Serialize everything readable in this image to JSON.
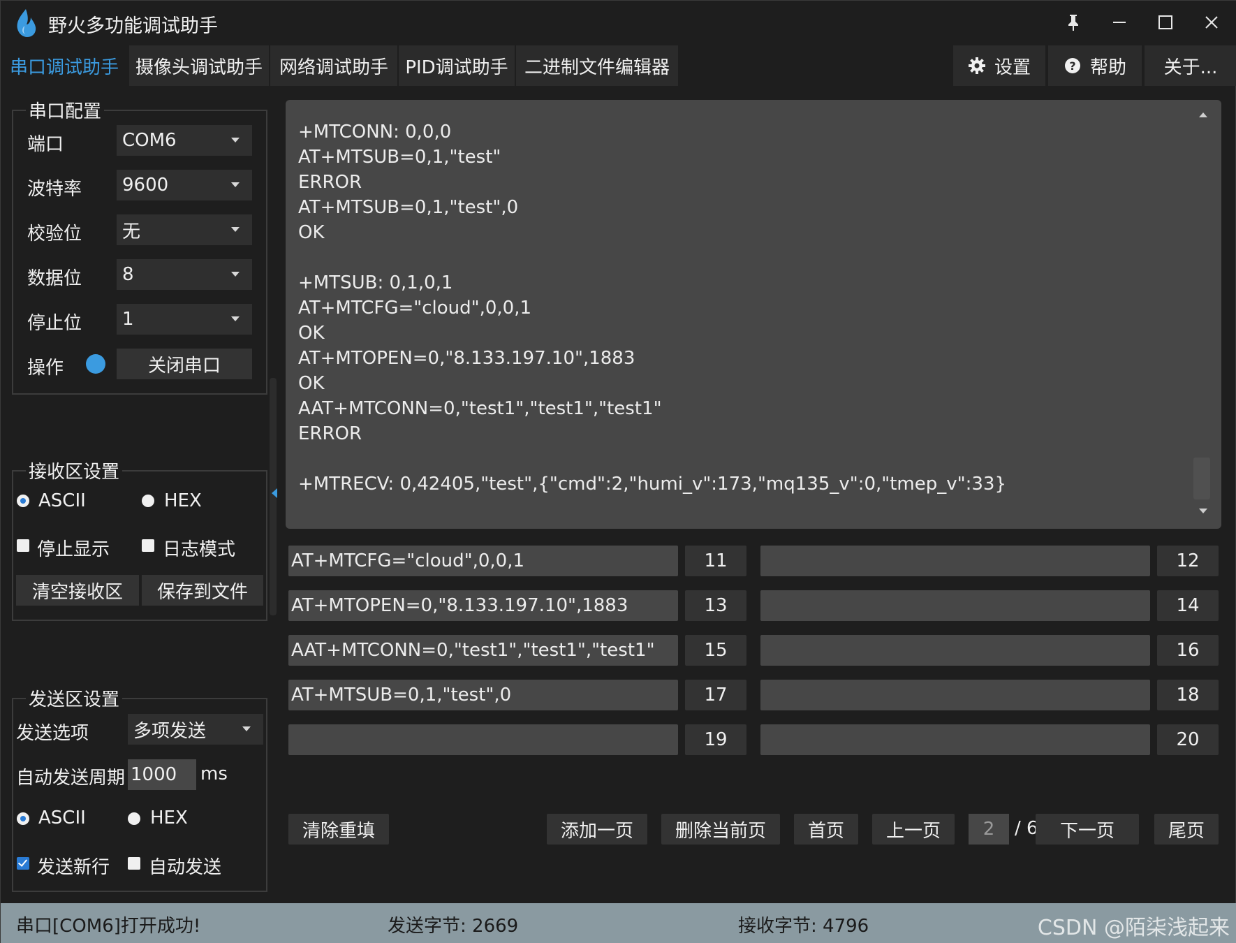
{
  "window": {
    "title": "野火多功能调试助手",
    "controls": {
      "pin": "📌",
      "minimize": "—",
      "maximize": "☐",
      "close": "✕"
    }
  },
  "tabs": [
    {
      "label": "串口调试助手",
      "active": true
    },
    {
      "label": "摄像头调试助手"
    },
    {
      "label": "网络调试助手"
    },
    {
      "label": "PID调试助手"
    },
    {
      "label": "二进制文件编辑器"
    }
  ],
  "top_right": {
    "settings": {
      "icon": "gear-icon",
      "label": "设置"
    },
    "help": {
      "icon": "help-icon",
      "label": "帮助"
    },
    "about": {
      "label": "关于..."
    }
  },
  "serial_config": {
    "title": "串口配置",
    "port": {
      "label": "端口",
      "value": "COM6"
    },
    "baud": {
      "label": "波特率",
      "value": "9600"
    },
    "parity": {
      "label": "校验位",
      "value": "无"
    },
    "databits": {
      "label": "数据位",
      "value": "8"
    },
    "stopbits": {
      "label": "停止位",
      "value": "1"
    },
    "operation": {
      "label": "操作",
      "button": "关闭串口",
      "led_color": "#3b9be0"
    }
  },
  "receive_settings": {
    "title": "接收区设置",
    "ascii": "ASCII",
    "hex": "HEX",
    "stop_display": "停止显示",
    "log_mode": "日志模式",
    "clear_button": "清空接收区",
    "save_button": "保存到文件"
  },
  "send_settings": {
    "title": "发送区设置",
    "option_label": "发送选项",
    "option_value": "多项发送",
    "period_label": "自动发送周期",
    "period_value": "1000",
    "period_unit": "ms",
    "ascii": "ASCII",
    "hex": "HEX",
    "newline": "发送新行",
    "auto_send": "自动发送"
  },
  "receive_area": {
    "text": "+MTCONN: 0,0,0\nAT+MTSUB=0,1,\"test\"\nERROR\nAT+MTSUB=0,1,\"test\",0\nOK\n\n+MTSUB: 0,1,0,1\nAT+MTCFG=\"cloud\",0,0,1\nOK\nAT+MTOPEN=0,\"8.133.197.10\",1883\nOK\nAAT+MTCONN=0,\"test1\",\"test1\",\"test1\"\nERROR\n\n+MTRECV: 0,42405,\"test\",{\"cmd\":2,\"humi_v\":173,\"mq135_v\":0,\"tmep_v\":33}"
  },
  "send_rows": [
    {
      "left_text": "AT+MTCFG=\"cloud\",0,0,1",
      "left_btn": "11",
      "right_text": "",
      "right_btn": "12"
    },
    {
      "left_text": "AT+MTOPEN=0,\"8.133.197.10\",1883",
      "left_btn": "13",
      "right_text": "",
      "right_btn": "14"
    },
    {
      "left_text": "AAT+MTCONN=0,\"test1\",\"test1\",\"test1\"",
      "left_btn": "15",
      "right_text": "",
      "right_btn": "16"
    },
    {
      "left_text": "AT+MTSUB=0,1,\"test\",0",
      "left_btn": "17",
      "right_text": "",
      "right_btn": "18"
    },
    {
      "left_text": "",
      "left_btn": "19",
      "right_text": "",
      "right_btn": "20"
    }
  ],
  "bottom_controls": {
    "clear_refill": "清除重填",
    "add_page": "添加一页",
    "delete_page": "删除当前页",
    "first_page": "首页",
    "prev_page": "上一页",
    "current_page": "2",
    "total_pages": "/ 6",
    "next_page": "下一页",
    "last_page": "尾页"
  },
  "status": {
    "message": "串口[COM6]打开成功!",
    "sent": "发送字节: 2669",
    "received": "接收字节: 4796",
    "watermark": "CSDN @陌柒浅起来"
  }
}
